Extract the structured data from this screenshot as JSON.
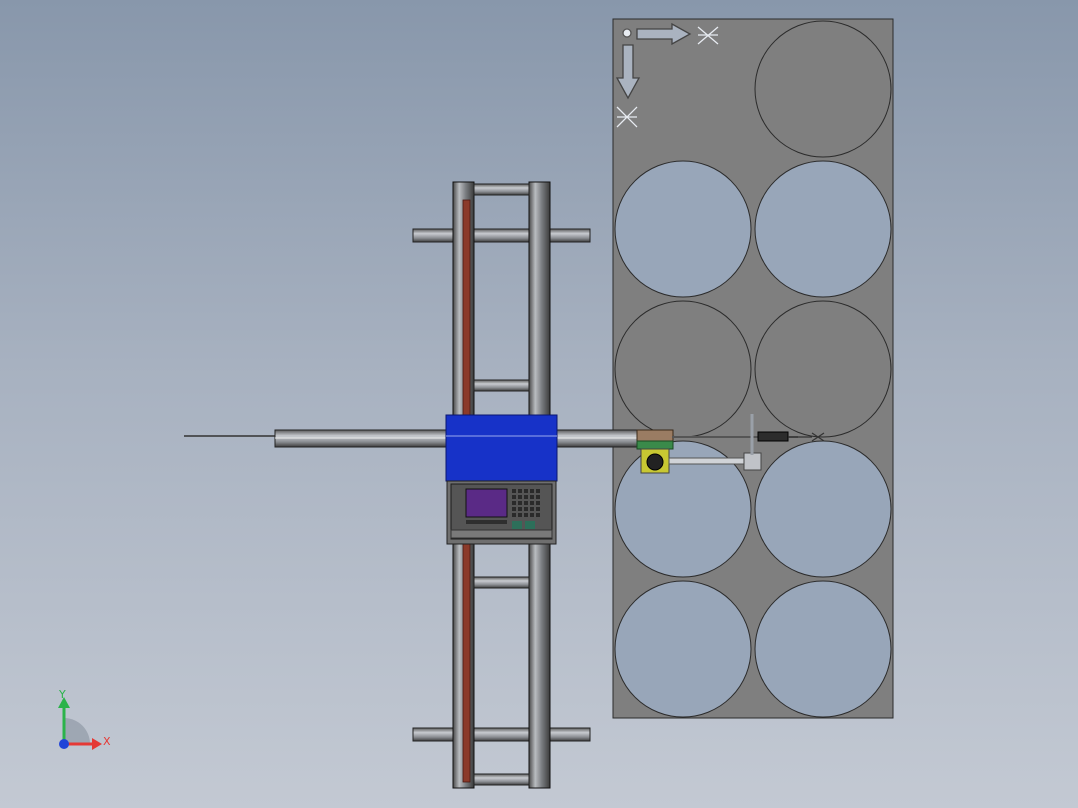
{
  "viewport": {
    "triad": {
      "x_label": "X",
      "y_label": "Y"
    },
    "table_marker": {
      "label": "X"
    }
  },
  "colors": {
    "background_top": "#8897ab",
    "background_bottom": "#c3c9d3",
    "table_fill": "#7f7f7f",
    "hole_filled": "#7f7f7f",
    "hole_cutout": "#98a6b9",
    "carriage_blue": "#1732c8",
    "rail_red": "#8b3a2a",
    "torch_yellow": "#c8c832",
    "screen_purple": "#5a2a86",
    "axis_x": "#e53935",
    "axis_y": "#2bb34a",
    "axis_z": "#2044d8"
  },
  "icons": [
    "coordinate-triad-icon",
    "datum-arrow-icon"
  ]
}
